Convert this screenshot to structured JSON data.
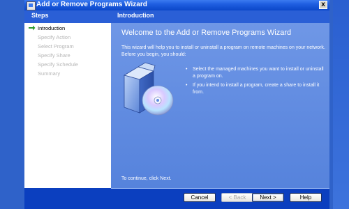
{
  "window": {
    "title": "Add or Remove Programs Wizard",
    "close_label": "x"
  },
  "steps": {
    "header": "Steps",
    "items": [
      {
        "label": "Introduction",
        "active": true
      },
      {
        "label": "Specify Action",
        "active": false
      },
      {
        "label": "Select Program",
        "active": false
      },
      {
        "label": "Specify Share",
        "active": false
      },
      {
        "label": "Specify Schedule",
        "active": false
      },
      {
        "label": "Summary",
        "active": false
      }
    ]
  },
  "content": {
    "header": "Introduction",
    "heading": "Welcome to the Add or Remove Programs Wizard",
    "intro": "This wizard will help you to install or uninstall a program on remote machines on your network. Before you begin, you should:",
    "bullets": [
      "Select the managed machines you want to install or uninstall a program on.",
      "If you intend to install a program, create a share to install it from."
    ],
    "continue_text": "To continue, click Next."
  },
  "buttons": {
    "cancel": "Cancel",
    "back": "< Back",
    "next": "Next >",
    "help": "Help"
  },
  "colors": {
    "title_bar": "#1f5ee0",
    "frame": "#0b3fbf",
    "content_bg": "#6f97e6",
    "step_arrow": "#2e9a2e"
  },
  "icons": {
    "step_arrow": "green-arrow-icon",
    "illustration": "software-box-cd-icon"
  }
}
